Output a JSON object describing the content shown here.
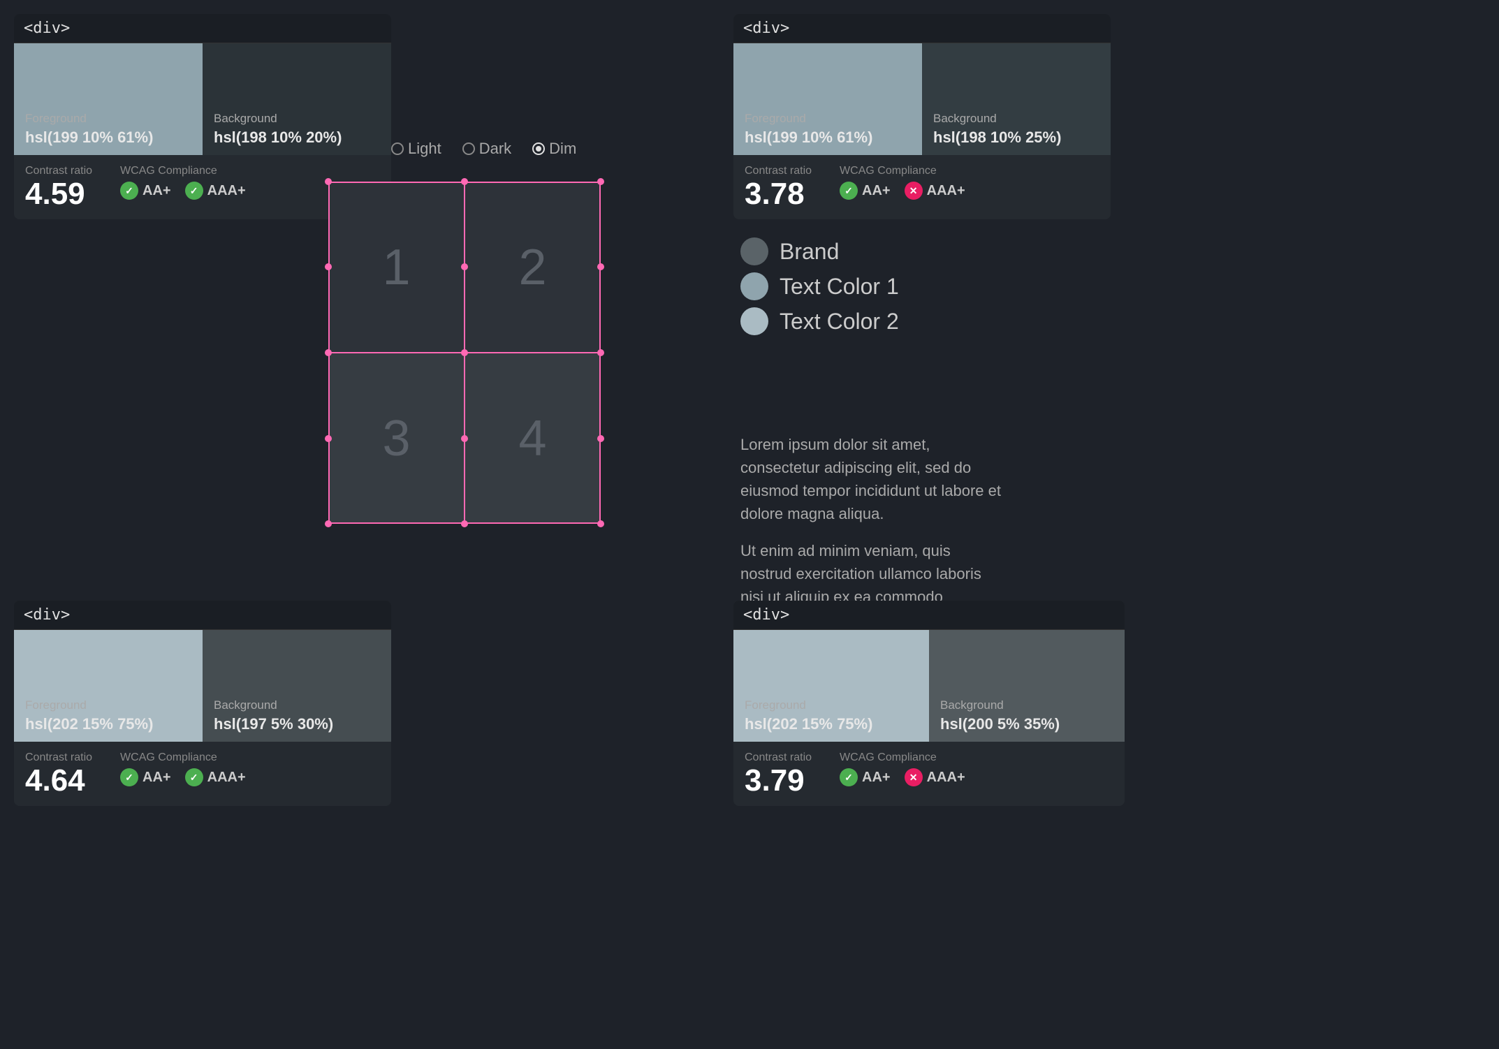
{
  "panels": {
    "top_left": {
      "title": "<div>",
      "foreground_label": "Foreground",
      "foreground_value": "hsl(199 10% 61%)",
      "background_label": "Background",
      "background_value": "hsl(198 10% 20%)",
      "foreground_color": "#8fa4ad",
      "background_color": "#2b3338",
      "contrast_label": "Contrast ratio",
      "contrast_value": "4.59",
      "wcag_label": "WCAG Compliance",
      "wcag_aa": "AA+",
      "wcag_aaa": "AAA+",
      "aa_pass": true,
      "aaa_pass": true
    },
    "top_right": {
      "title": "<div>",
      "foreground_label": "Foreground",
      "foreground_value": "hsl(199 10% 61%)",
      "background_label": "Background",
      "background_value": "hsl(198 10% 25%)",
      "foreground_color": "#8fa4ad",
      "background_color": "#333d42",
      "contrast_label": "Contrast ratio",
      "contrast_value": "3.78",
      "wcag_label": "WCAG Compliance",
      "wcag_aa": "AA+",
      "wcag_aaa": "AAA+",
      "aa_pass": true,
      "aaa_pass": false
    },
    "bottom_left": {
      "title": "<div>",
      "foreground_label": "Foreground",
      "foreground_value": "hsl(202 15% 75%)",
      "background_label": "Background",
      "background_value": "hsl(197 5% 30%)",
      "foreground_color": "#aabbc3",
      "background_color": "#454d51",
      "contrast_label": "Contrast ratio",
      "contrast_value": "4.64",
      "wcag_label": "WCAG Compliance",
      "wcag_aa": "AA+",
      "wcag_aaa": "AAA+",
      "aa_pass": true,
      "aaa_pass": true
    },
    "bottom_right": {
      "title": "<div>",
      "foreground_label": "Foreground",
      "foreground_value": "hsl(202 15% 75%)",
      "background_label": "Background",
      "background_value": "hsl(200 5% 35%)",
      "foreground_color": "#aabbc3",
      "background_color": "#525a5e",
      "contrast_label": "Contrast ratio",
      "contrast_value": "3.79",
      "wcag_label": "WCAG Compliance",
      "wcag_aa": "AA+",
      "wcag_aaa": "AAA+",
      "aa_pass": true,
      "aaa_pass": false
    }
  },
  "theme": {
    "options": [
      "Light",
      "Dark",
      "Dim"
    ],
    "selected": "Dim"
  },
  "grid": {
    "cells": [
      "1",
      "2",
      "3",
      "4"
    ]
  },
  "legend": {
    "items": [
      {
        "label": "Brand",
        "color": "#5a6368"
      },
      {
        "label": "Text Color 1",
        "color": "#8fa4ad"
      },
      {
        "label": "Text Color 2",
        "color": "#aabbc3"
      }
    ]
  },
  "lorem": {
    "paragraph1": "Lorem ipsum dolor sit amet, consectetur adipiscing elit, sed do eiusmod tempor incididunt ut labore et dolore magna aliqua.",
    "paragraph2": "Ut enim ad minim veniam, quis nostrud exercitation ullamco laboris nisi ut aliquip ex ea commodo consequat."
  }
}
